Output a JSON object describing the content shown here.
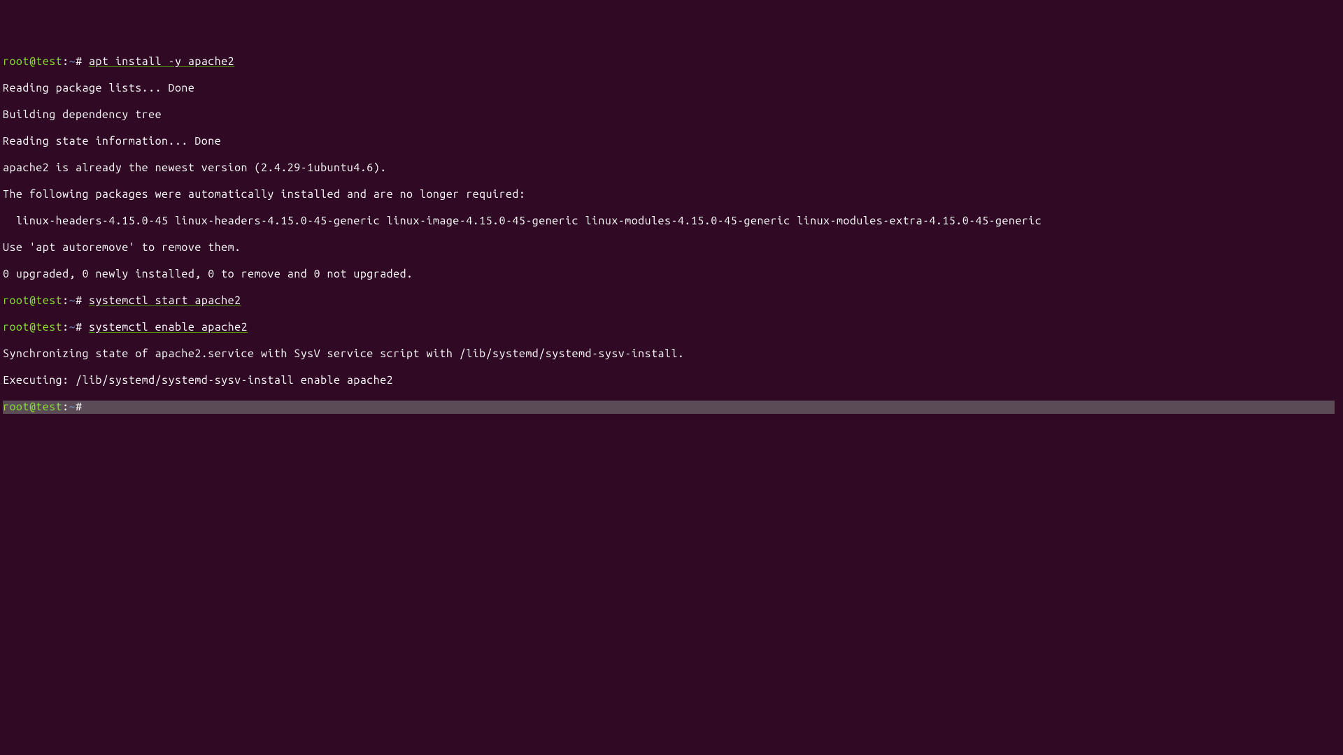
{
  "prompt": {
    "user_host": "root@test",
    "colon": ":",
    "path": "~",
    "hash": "# "
  },
  "lines": {
    "cmd1": "apt install -y apache2",
    "out1": "Reading package lists... Done",
    "out2": "Building dependency tree",
    "out3": "Reading state information... Done",
    "out4": "apache2 is already the newest version (2.4.29-1ubuntu4.6).",
    "out5": "The following packages were automatically installed and are no longer required:",
    "out6": "  linux-headers-4.15.0-45 linux-headers-4.15.0-45-generic linux-image-4.15.0-45-generic linux-modules-4.15.0-45-generic linux-modules-extra-4.15.0-45-generic",
    "out7": "Use 'apt autoremove' to remove them.",
    "out8": "0 upgraded, 0 newly installed, 0 to remove and 0 not upgraded.",
    "cmd2": "systemctl start apache2",
    "cmd3": "systemctl enable apache2",
    "out9": "Synchronizing state of apache2.service with SysV service script with /lib/systemd/systemd-sysv-install.",
    "out10": "Executing: /lib/systemd/systemd-sysv-install enable apache2"
  }
}
